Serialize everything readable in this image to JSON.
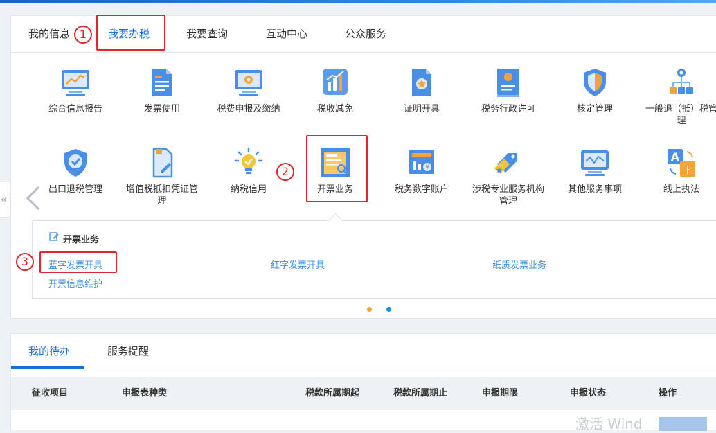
{
  "colors": {
    "accent": "#1d6fd8",
    "annotation_red": "#e1252a",
    "link": "#3f8fe0",
    "dot_active": "#f0a33a",
    "dot_inactive": "#1d8fd8"
  },
  "top_tabs": [
    "我的信息",
    "我要办税",
    "我要查询",
    "互动中心",
    "公众服务"
  ],
  "active_top_tab": "我要办税",
  "annotations": [
    "1",
    "2",
    "3"
  ],
  "grid_row1": [
    {
      "label": "综合信息报告",
      "icon": "monitor-chart-icon"
    },
    {
      "label": "发票使用",
      "icon": "invoice-document-icon"
    },
    {
      "label": "税费申报及缴纳",
      "icon": "monitor-gear-icon"
    },
    {
      "label": "税收减免",
      "icon": "bar-chart-icon"
    },
    {
      "label": "证明开具",
      "icon": "certificate-icon"
    },
    {
      "label": "税务行政许可",
      "icon": "license-badge-icon"
    },
    {
      "label": "核定管理",
      "icon": "shield-icon"
    },
    {
      "label": "一般退（抵）税管",
      "label2": "理",
      "icon": "org-tree-icon"
    }
  ],
  "grid_row2": [
    {
      "label": "出口退税管理",
      "icon": "shield-check-icon"
    },
    {
      "label": "增值税抵扣凭证管",
      "label2": "理",
      "icon": "doc-pen-icon"
    },
    {
      "label": "纳税信用",
      "icon": "lightbulb-icon"
    },
    {
      "label": "开票业务",
      "icon": "invoice-issue-icon"
    },
    {
      "label": "税务数字账户",
      "icon": "digital-account-icon"
    },
    {
      "label": "涉税专业服务机构",
      "label2": "管理",
      "icon": "tag-star-icon"
    },
    {
      "label": "其他服务事项",
      "icon": "monitor-wave-icon"
    },
    {
      "label": "线上执法",
      "icon": "translate-icon"
    }
  ],
  "submenu": {
    "title": "开票业务",
    "links": [
      "蓝字发票开具",
      "红字发票开具",
      "纸质发票业务",
      "开票信息维护"
    ]
  },
  "bottom_tabs": [
    "我的待办",
    "服务提醒"
  ],
  "table_headers": [
    "征收项目",
    "申报表种类",
    "税款所属期起",
    "税款所属期止",
    "申报期限",
    "申报状态",
    "操作"
  ],
  "watermark": "激活 Wind"
}
